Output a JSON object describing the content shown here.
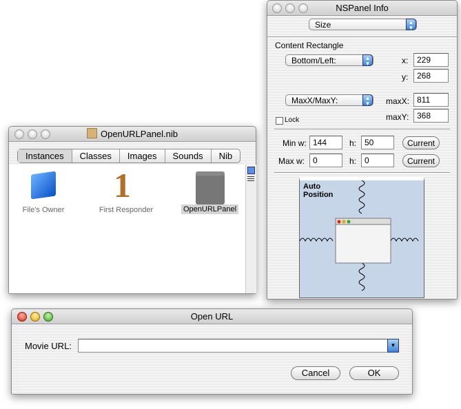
{
  "info_panel": {
    "title": "NSPanel Info",
    "section_popup": "Size",
    "content_rect_label": "Content Rectangle",
    "origin_popup": "Bottom/Left:",
    "x_label": "x:",
    "x_value": "229",
    "y_label": "y:",
    "y_value": "268",
    "max_popup": "MaxX/MaxY:",
    "maxx_label": "maxX:",
    "maxx_value": "811",
    "maxy_label": "maxY:",
    "maxy_value": "368",
    "lock_label": "Lock",
    "min_w_label": "Min w:",
    "min_w_value": "144",
    "min_h_label": "h:",
    "min_h_value": "50",
    "max_w_label": "Max w:",
    "max_w_value": "0",
    "max_h_label": "h:",
    "max_h_value": "0",
    "current_label": "Current",
    "auto_position_label": "Auto Position"
  },
  "nib_window": {
    "title": "OpenURLPanel.nib",
    "tabs": [
      "Instances",
      "Classes",
      "Images",
      "Sounds",
      "Nib"
    ],
    "items": [
      {
        "label": "File's Owner",
        "icon": "blue-cube-icon"
      },
      {
        "label": "First Responder",
        "icon": "number-one-icon"
      },
      {
        "label": "OpenURLPanel",
        "icon": "panel-window-icon",
        "selected": true
      }
    ]
  },
  "open_url": {
    "title": "Open URL",
    "movie_url_label": "Movie URL:",
    "movie_url_value": "",
    "cancel_label": "Cancel",
    "ok_label": "OK"
  }
}
